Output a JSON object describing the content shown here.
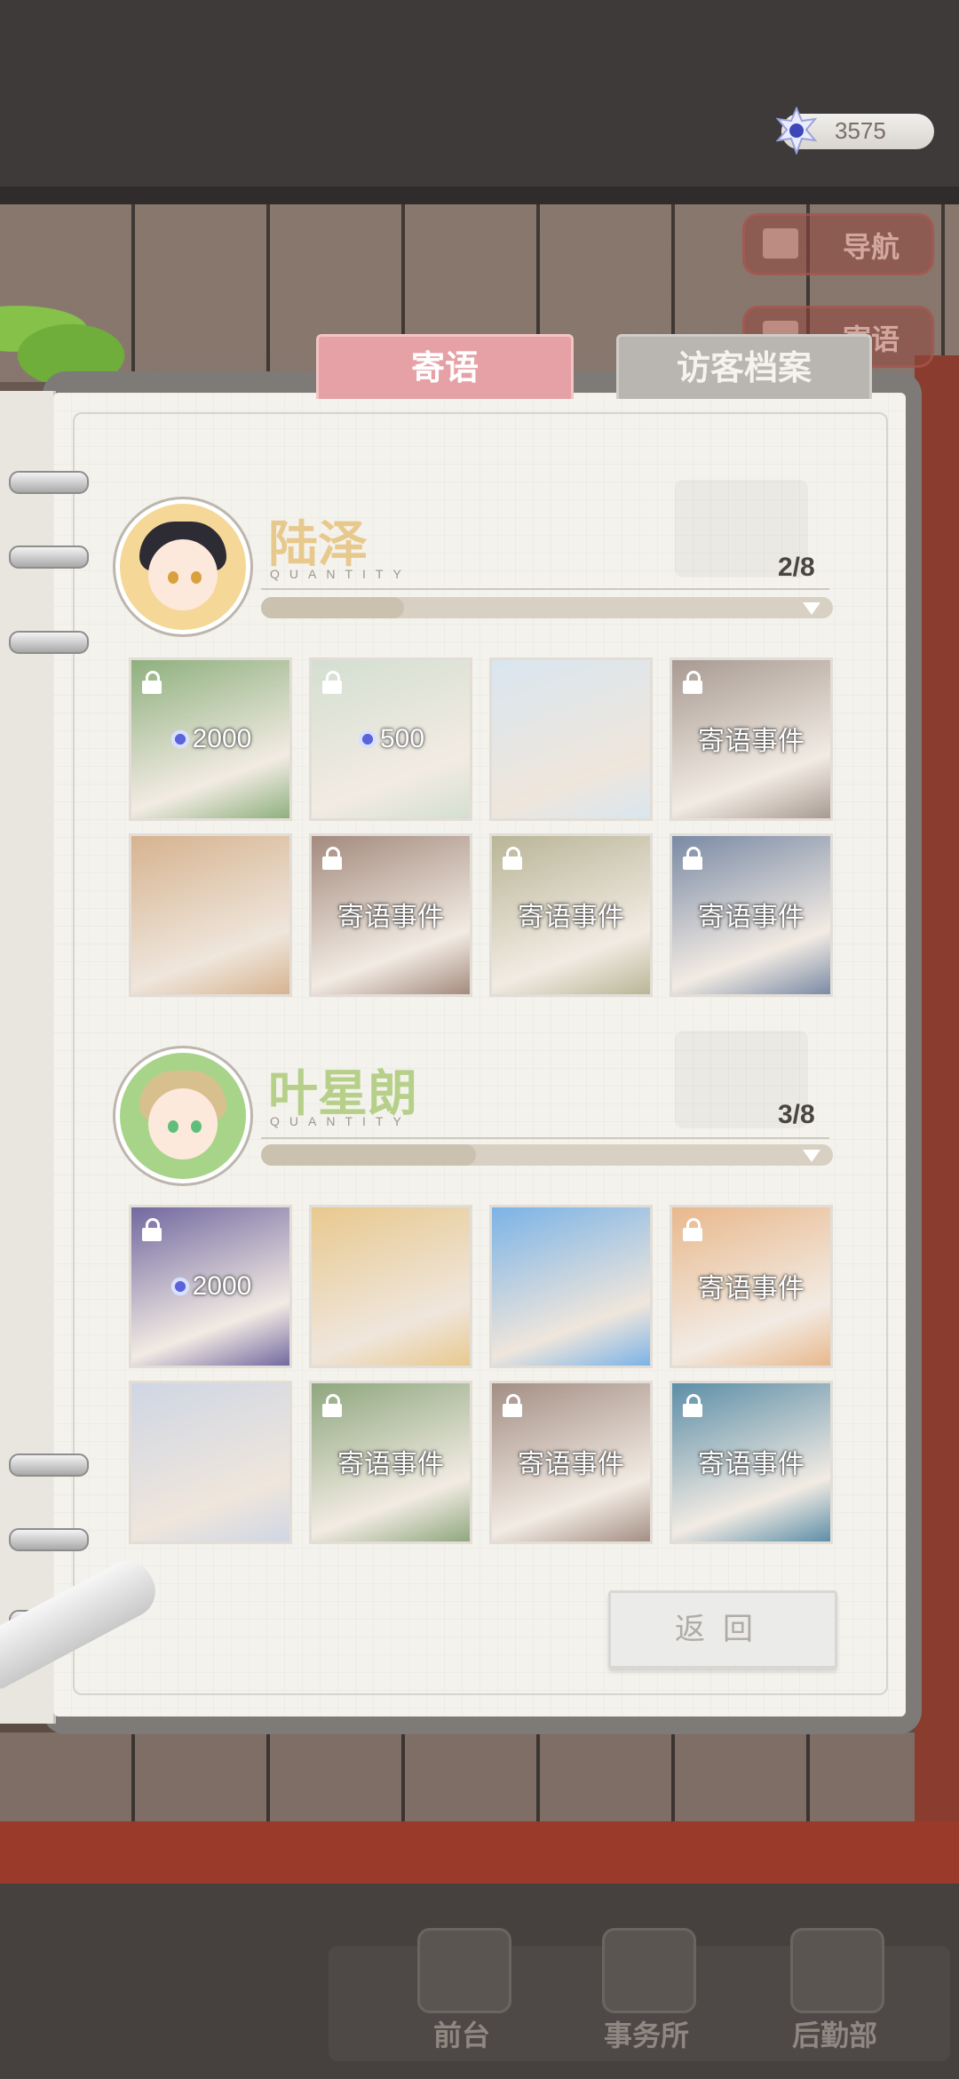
{
  "currency": {
    "amount": "3575",
    "icon": "gem-icon"
  },
  "side_nav": [
    {
      "label": "导航",
      "icon": "map-icon"
    },
    {
      "label": "寄语",
      "icon": "letter-icon"
    }
  ],
  "tabs": [
    {
      "label": "寄语",
      "active": true
    },
    {
      "label": "访客档案",
      "active": false
    }
  ],
  "characters": [
    {
      "name": "陆泽",
      "quantity_label": "QUANTITY",
      "count": "2/8",
      "progress": 0.25,
      "name_color": "#e8c98d",
      "hair_color": "#2d2b33",
      "avatar_bg": "#f5d898",
      "cards": [
        {
          "locked": true,
          "cost": "2000",
          "event": ""
        },
        {
          "locked": true,
          "cost": "500",
          "event": ""
        },
        {
          "locked": false,
          "cost": "",
          "event": ""
        },
        {
          "locked": true,
          "cost": "",
          "event": "寄语事件"
        },
        {
          "locked": false,
          "cost": "",
          "event": ""
        },
        {
          "locked": true,
          "cost": "",
          "event": "寄语事件"
        },
        {
          "locked": true,
          "cost": "",
          "event": "寄语事件"
        },
        {
          "locked": true,
          "cost": "",
          "event": "寄语事件"
        }
      ]
    },
    {
      "name": "叶星朗",
      "quantity_label": "QUANTITY",
      "count": "3/8",
      "progress": 0.375,
      "name_color": "#b6d08a",
      "hair_color": "#d7c08e",
      "avatar_bg": "#a8d48a",
      "cards": [
        {
          "locked": true,
          "cost": "2000",
          "event": ""
        },
        {
          "locked": false,
          "cost": "",
          "event": ""
        },
        {
          "locked": false,
          "cost": "",
          "event": ""
        },
        {
          "locked": true,
          "cost": "",
          "event": "寄语事件"
        },
        {
          "locked": false,
          "cost": "",
          "event": ""
        },
        {
          "locked": true,
          "cost": "",
          "event": "寄语事件"
        },
        {
          "locked": true,
          "cost": "",
          "event": "寄语事件"
        },
        {
          "locked": true,
          "cost": "",
          "event": "寄语事件"
        }
      ]
    }
  ],
  "back_button": "返回",
  "bottom_nav": [
    {
      "label": "前台",
      "icon": "front-desk-icon"
    },
    {
      "label": "事务所",
      "icon": "office-icon"
    },
    {
      "label": "后勤部",
      "icon": "logistics-icon"
    }
  ],
  "colors": {
    "tab_active": "#e6a1a6",
    "tab_inactive": "#b9b5b1",
    "panel_bg": "#f4f2ec"
  }
}
